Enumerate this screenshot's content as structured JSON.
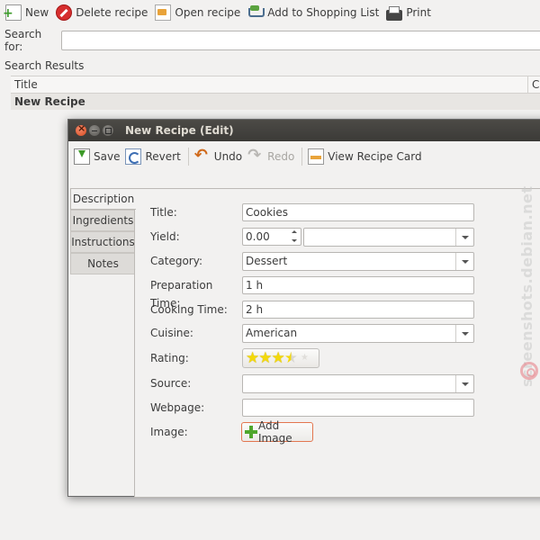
{
  "toolbar": {
    "new_label": "New",
    "delete_label": "Delete recipe",
    "open_label": "Open recipe",
    "shopping_label": "Add to Shopping List",
    "print_label": "Print"
  },
  "search": {
    "label": "Search for:",
    "value": ""
  },
  "results": {
    "label": "Search Results",
    "columns": [
      "Title",
      "Ca"
    ],
    "rows": [
      {
        "title": "New Recipe"
      }
    ]
  },
  "dialog": {
    "title": "New Recipe (Edit)",
    "toolbar": {
      "save_label": "Save",
      "revert_label": "Revert",
      "undo_label": "Undo",
      "redo_label": "Redo",
      "view_card_label": "View Recipe Card"
    },
    "tabs": [
      "Description",
      "Ingredients",
      "Instructions",
      "Notes"
    ],
    "active_tab": "Description",
    "fields": {
      "title_label": "Title:",
      "title_value": "Cookies",
      "yield_label": "Yield:",
      "yield_value": "0.00",
      "yield_unit": "",
      "category_label": "Category:",
      "category_value": "Dessert",
      "prep_label": "Preparation Time:",
      "prep_value": "1 h",
      "cook_label": "Cooking Time:",
      "cook_value": "2 h",
      "cuisine_label": "Cuisine:",
      "cuisine_value": "American",
      "rating_label": "Rating:",
      "rating_stars": 3.5,
      "rating_max": 5,
      "source_label": "Source:",
      "source_value": "",
      "webpage_label": "Webpage:",
      "webpage_value": "",
      "image_label": "Image:",
      "add_image_label": "Add Image"
    }
  },
  "watermark": "screenshots.debian.net"
}
